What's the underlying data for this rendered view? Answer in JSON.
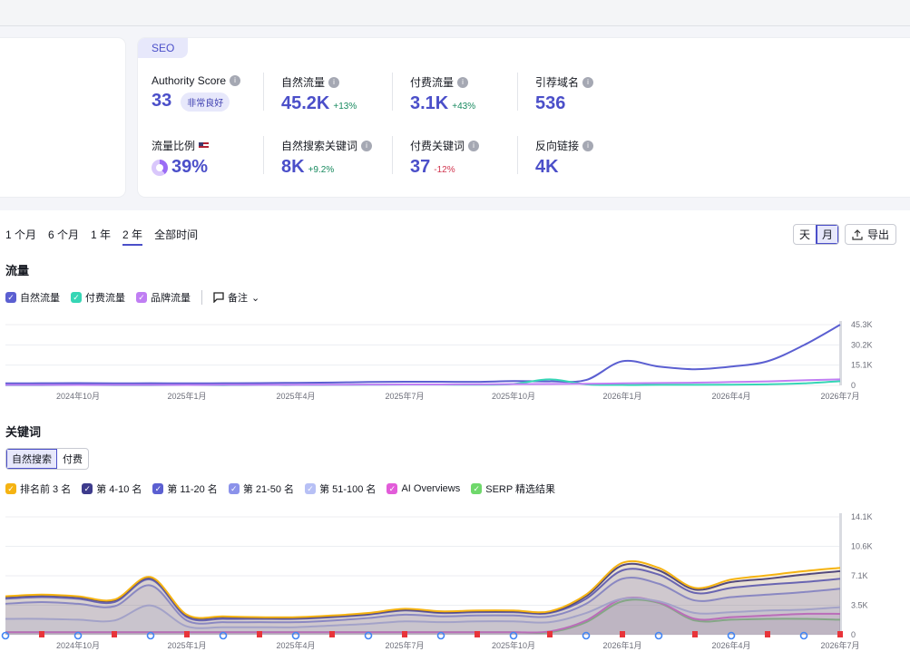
{
  "seo_card": {
    "badge": "SEO",
    "metrics": [
      {
        "label": "Authority Score",
        "value": "33",
        "badge": "非常良好"
      },
      {
        "label": "自然流量",
        "value": "45.2K",
        "delta": "+13%",
        "trend": "pos"
      },
      {
        "label": "付费流量",
        "value": "3.1K",
        "delta": "+43%",
        "trend": "pos"
      },
      {
        "label": "引荐域名",
        "value": "536"
      },
      {
        "label": "流量比例",
        "value": "39%",
        "donut_pct": 39
      },
      {
        "label": "自然搜索关键词",
        "value": "8K",
        "delta": "+9.2%",
        "trend": "pos"
      },
      {
        "label": "付费关键词",
        "value": "37",
        "delta": "-12%",
        "trend": "neg"
      },
      {
        "label": "反向链接",
        "value": "4K"
      }
    ]
  },
  "period_tabs": [
    "1 个月",
    "6 个月",
    "1 年",
    "2 年",
    "全部时间"
  ],
  "period_active": "2 年",
  "granularity": {
    "day": "天",
    "month": "月",
    "selected": "月"
  },
  "export_label": "导出",
  "traffic": {
    "title": "流量",
    "legend": [
      {
        "label": "自然流量",
        "color": "#5b5fd1"
      },
      {
        "label": "付费流量",
        "color": "#36d6b5"
      },
      {
        "label": "品牌流量",
        "color": "#c07ef3"
      }
    ],
    "notes_label": "备注"
  },
  "keywords": {
    "title": "关键词",
    "toggle": [
      "自然搜索",
      "付费"
    ],
    "toggle_selected": "自然搜索",
    "legend": [
      {
        "label": "排名前 3 名",
        "color": "#f5b312"
      },
      {
        "label": "第 4-10 名",
        "color": "#3d3b8c"
      },
      {
        "label": "第 11-20 名",
        "color": "#5b5fd1"
      },
      {
        "label": "第 21-50 名",
        "color": "#8b92ea"
      },
      {
        "label": "第 51-100 名",
        "color": "#b7c0f5"
      },
      {
        "label": "AI Overviews",
        "color": "#e25cd9"
      },
      {
        "label": "SERP 精选结果",
        "color": "#6fd86b"
      }
    ]
  },
  "chart_data": [
    {
      "type": "line",
      "title": "流量",
      "x": [
        "2024-08",
        "2024-09",
        "2024-10",
        "2024-11",
        "2024-12",
        "2025-01",
        "2025-02",
        "2025-03",
        "2025-04",
        "2025-05",
        "2025-06",
        "2025-07",
        "2025-08",
        "2025-09",
        "2025-10",
        "2025-11",
        "2025-12",
        "2026-01",
        "2026-02",
        "2026-03",
        "2026-04",
        "2026-05",
        "2026-06",
        "2026-07"
      ],
      "x_tick_labels": [
        "2024年10月",
        "2025年1月",
        "2025年4月",
        "2025年7月",
        "2025年10月",
        "2026年1月",
        "2026年4月",
        "2026年7月"
      ],
      "y_ticks": [
        "0",
        "15.1K",
        "30.2K",
        "45.3K"
      ],
      "ylim": [
        0,
        45300
      ],
      "series": [
        {
          "name": "自然流量",
          "color": "#5b5fd1",
          "values": [
            1500,
            1600,
            1700,
            1500,
            1600,
            1500,
            1600,
            1700,
            1900,
            2100,
            2500,
            2700,
            2700,
            2600,
            3200,
            3000,
            4000,
            18000,
            14000,
            12000,
            14000,
            18000,
            30000,
            45200
          ]
        },
        {
          "name": "付费流量",
          "color": "#36d6b5",
          "values": [
            200,
            200,
            300,
            200,
            200,
            300,
            200,
            300,
            300,
            400,
            500,
            600,
            600,
            500,
            1000,
            4500,
            800,
            300,
            400,
            400,
            500,
            800,
            1500,
            3100
          ]
        },
        {
          "name": "品牌流量",
          "color": "#c07ef3",
          "values": [
            300,
            300,
            350,
            300,
            350,
            350,
            400,
            400,
            450,
            500,
            600,
            700,
            700,
            800,
            900,
            1000,
            1200,
            1500,
            1800,
            2000,
            2500,
            3000,
            3800,
            4500
          ]
        }
      ]
    },
    {
      "type": "area",
      "title": "关键词",
      "x": [
        "2024-08",
        "2024-09",
        "2024-10",
        "2024-11",
        "2024-12",
        "2025-01",
        "2025-02",
        "2025-03",
        "2025-04",
        "2025-05",
        "2025-06",
        "2025-07",
        "2025-08",
        "2025-09",
        "2025-10",
        "2025-11",
        "2025-12",
        "2026-01",
        "2026-02",
        "2026-03",
        "2026-04",
        "2026-05",
        "2026-06",
        "2026-07"
      ],
      "x_tick_labels": [
        "2024年10月",
        "2025年1月",
        "2025年4月",
        "2025年7月",
        "2025年10月",
        "2026年1月",
        "2026年4月",
        "2026年7月"
      ],
      "y_ticks": [
        "0",
        "3.5K",
        "7.1K",
        "10.6K",
        "14.1K"
      ],
      "ylim": [
        0,
        14100
      ],
      "stacked": true,
      "series": [
        {
          "name": "排名前 3 名",
          "color": "#f5b312",
          "values": [
            4600,
            4800,
            4600,
            4200,
            6900,
            2400,
            2200,
            2100,
            2100,
            2300,
            2600,
            3100,
            2800,
            2900,
            2900,
            2800,
            4800,
            8600,
            8000,
            5600,
            6600,
            7100,
            7600,
            8000
          ]
        },
        {
          "name": "第 4-10 名",
          "color": "#3d3b8c",
          "values": [
            4500,
            4700,
            4500,
            4100,
            6800,
            2300,
            2100,
            2000,
            2000,
            2200,
            2500,
            3000,
            2700,
            2800,
            2800,
            2700,
            4600,
            8300,
            7700,
            5400,
            6300,
            6700,
            7200,
            7600
          ]
        },
        {
          "name": "第 11-20 名",
          "color": "#5b5fd1",
          "values": [
            4300,
            4500,
            4300,
            3900,
            6600,
            2100,
            1900,
            1900,
            1900,
            2100,
            2400,
            2900,
            2600,
            2700,
            2700,
            2600,
            4300,
            7700,
            7200,
            5000,
            5600,
            6000,
            6300,
            6700
          ]
        },
        {
          "name": "第 21-50 名",
          "color": "#8b92ea",
          "values": [
            3700,
            3900,
            3700,
            3400,
            5900,
            1700,
            1500,
            1500,
            1500,
            1700,
            2000,
            2400,
            2200,
            2300,
            2300,
            2200,
            3700,
            6700,
            6100,
            4100,
            4500,
            4800,
            5100,
            5500
          ]
        },
        {
          "name": "第 51-100 名",
          "color": "#b7c0f5",
          "values": [
            1900,
            1900,
            1800,
            1700,
            3500,
            1000,
            900,
            900,
            900,
            1100,
            1300,
            1600,
            1500,
            1600,
            1600,
            1500,
            2600,
            4300,
            4000,
            2600,
            2700,
            2900,
            3000,
            3300
          ]
        },
        {
          "name": "AI Overviews",
          "color": "#e25cd9",
          "values": [
            300,
            300,
            300,
            300,
            300,
            300,
            300,
            300,
            300,
            300,
            300,
            300,
            300,
            300,
            300,
            400,
            1700,
            4300,
            3900,
            1900,
            2100,
            2300,
            2500,
            2500
          ]
        },
        {
          "name": "SERP 精选结果",
          "color": "#6fd86b",
          "values": [
            300,
            300,
            300,
            300,
            300,
            300,
            300,
            300,
            300,
            300,
            300,
            300,
            300,
            300,
            300,
            300,
            1500,
            4000,
            3800,
            1700,
            1800,
            1900,
            1900,
            1800
          ]
        }
      ]
    }
  ]
}
